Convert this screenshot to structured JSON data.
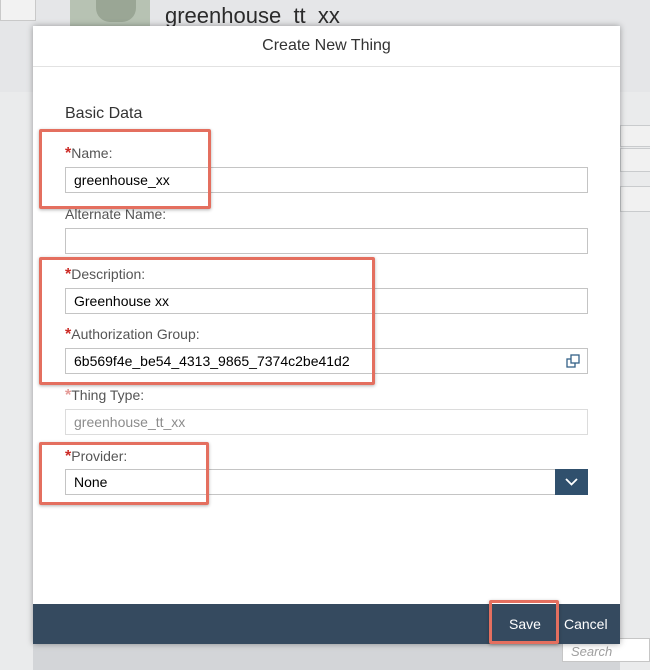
{
  "background": {
    "page_title": "greenhouse_tt_xx",
    "search_placeholder": "Search"
  },
  "dialog": {
    "title": "Create New Thing",
    "section_title": "Basic Data",
    "fields": {
      "name": {
        "label": "Name:",
        "required": "*",
        "value": "greenhouse_xx"
      },
      "alternate_name": {
        "label": "Alternate Name:",
        "value": ""
      },
      "description": {
        "label": "Description:",
        "required": "*",
        "value": "Greenhouse xx"
      },
      "authorization_group": {
        "label": "Authorization Group:",
        "required": "*",
        "value": "6b569f4e_be54_4313_9865_7374c2be41d2",
        "icon": "value-help-icon"
      },
      "thing_type": {
        "label": "Thing Type:",
        "required": "*",
        "value": "greenhouse_tt_xx"
      },
      "provider": {
        "label": "Provider:",
        "required": "*",
        "value": "None",
        "icon": "chevron-down-icon"
      }
    },
    "footer": {
      "save_label": "Save",
      "cancel_label": "Cancel"
    }
  },
  "colors": {
    "accent": "#354a5f",
    "required_marker": "#cc2a25",
    "highlight_border": "#e46f5f",
    "dropdown_button": "#30506d"
  }
}
